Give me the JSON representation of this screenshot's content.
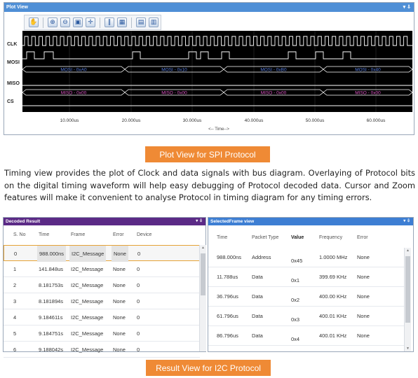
{
  "plot_view": {
    "title": "Plot View",
    "controls": "▾ ⇩",
    "toolbar_icons": [
      "hand-icon",
      "zoom-in-icon",
      "zoom-out-icon",
      "zoom-fit-icon",
      "cursor-icon",
      "bars-icon",
      "grid-icon",
      "markers-icon",
      "chart-icon"
    ],
    "toolbar_glyphs": [
      "✋",
      "⊕",
      "⊖",
      "▣",
      "✛",
      "‖",
      "▦",
      "▤",
      "▥"
    ],
    "signals": [
      "CLK",
      "MOSI",
      "MISO",
      "CS"
    ],
    "mosi_labels": [
      "MOSI - 0xA0",
      "MOSI - 0x10",
      "MOSI - 0xB0",
      "MOSI - 0x40"
    ],
    "miso_labels": [
      "MISO - 0x00",
      "MISO - 0x00",
      "MISO - 0x00",
      "MISO - 0x00"
    ],
    "time_ticks": [
      "10.000us",
      "20.000us",
      "30.000us",
      "40.000us",
      "50.000us",
      "60.000us"
    ],
    "time_axis_label": "<-- Time-->"
  },
  "captions": {
    "spi": "Plot View for SPI Protocol",
    "i2c": "Result View for I2C Protocol"
  },
  "paragraph": "Timing view provides the plot of Clock and data signals with bus diagram. Overlaying of Protocol bits on the digital timing waveform will help easy debugging of Protocol decoded data. Cursor and Zoom features will make it convenient to analyse Protocol in timing diagram for any timing errors.",
  "decoded_result": {
    "title": "Decoded Result",
    "title_color": "#5b2a86",
    "controls": "▾ ⇩",
    "headers": [
      "S. No",
      "Time",
      "Frame",
      "Error",
      "Device"
    ],
    "rows": [
      [
        "0",
        "988.000ns",
        "I2C_Message",
        "None",
        "0"
      ],
      [
        "1",
        "141.848us",
        "I2C_Message",
        "None",
        "0"
      ],
      [
        "2",
        "8.181753s",
        "I2C_Message",
        "None",
        "0"
      ],
      [
        "3",
        "8.181894s",
        "I2C_Message",
        "None",
        "0"
      ],
      [
        "4",
        "9.184611s",
        "I2C_Message",
        "None",
        "0"
      ],
      [
        "5",
        "9.184751s",
        "I2C_Message",
        "None",
        "0"
      ],
      [
        "6",
        "9.188042s",
        "I2C_Message",
        "None",
        "0"
      ]
    ]
  },
  "selected_frame": {
    "title": "SelectedFrame view",
    "title_color": "#3d7ed3",
    "controls": "▾ ⇩",
    "headers": [
      "Time",
      "Packet Type",
      "Value",
      "Frequency",
      "Error"
    ],
    "rows": [
      [
        "988.000ns",
        "Address",
        "0x45",
        "1.0000 MHz",
        "None"
      ],
      [
        "11.788us",
        "Data",
        "0x1",
        "399.69 KHz",
        "None"
      ],
      [
        "36.796us",
        "Data",
        "0x2",
        "400.00 KHz",
        "None"
      ],
      [
        "61.796us",
        "Data",
        "0x3",
        "400.01 KHz",
        "None"
      ],
      [
        "86.796us",
        "Data",
        "0x4",
        "400.01 KHz",
        "None"
      ]
    ]
  }
}
